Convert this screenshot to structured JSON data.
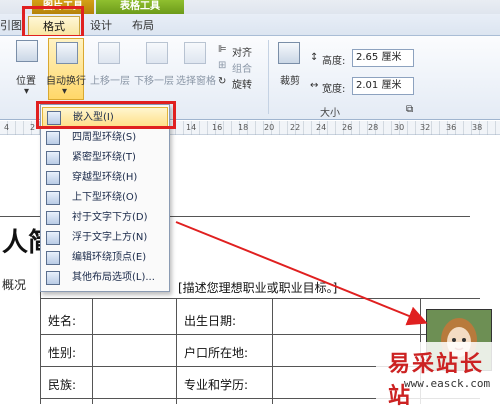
{
  "ribbon": {
    "contextual_groups": {
      "picture_tools": "图片工具",
      "table_tools": "表格工具"
    },
    "tabs": {
      "left_partial": "引图",
      "format": "格式",
      "design": "设计",
      "layout": "布局"
    },
    "buttons": {
      "position": "位置",
      "wrap_text": "自动换行",
      "bring_forward": "上移一层",
      "send_backward": "下移一层",
      "selection_pane": "选择窗格",
      "align": "对齐",
      "group": "组合",
      "rotate": "旋转",
      "crop": "裁剪"
    },
    "size": {
      "height_label": "高度:",
      "height_value": "2.65 厘米",
      "width_label": "宽度:",
      "width_value": "2.01 厘米",
      "group_label": "大小"
    }
  },
  "ruler": {
    "numbers": [
      "4",
      "2",
      "4",
      "6",
      "8",
      "10",
      "12",
      "14",
      "16",
      "18",
      "20",
      "22",
      "24",
      "26",
      "28",
      "30",
      "32",
      "36",
      "38"
    ]
  },
  "wrap_menu": {
    "items": [
      {
        "label": "嵌入型(I)",
        "selected": true
      },
      {
        "label": "四周型环绕(S)"
      },
      {
        "label": "紧密型环绕(T)"
      },
      {
        "label": "穿越型环绕(H)"
      },
      {
        "label": "上下型环绕(O)"
      },
      {
        "label": "衬于文字下方(D)"
      },
      {
        "label": "浮于文字上方(N)"
      },
      {
        "label": "编辑环绕顶点(E)"
      },
      {
        "label": "其他布局选项(L)..."
      }
    ]
  },
  "document": {
    "title": "人简",
    "summary": "概况",
    "objective_fragment": "[描述您理想职业或职业目标。]",
    "rows": [
      {
        "left": "姓名:",
        "right": "出生日期:"
      },
      {
        "left": "性别:",
        "right": "户口所在地:"
      },
      {
        "left": "民族:",
        "right": "专业和学历:"
      }
    ]
  },
  "watermark": {
    "brand": "易采站长站",
    "url": "www.easck.com"
  },
  "colors": {
    "highlight": "#e02020",
    "picture_tools": "#c4920f",
    "table_tools": "#7aa824"
  }
}
